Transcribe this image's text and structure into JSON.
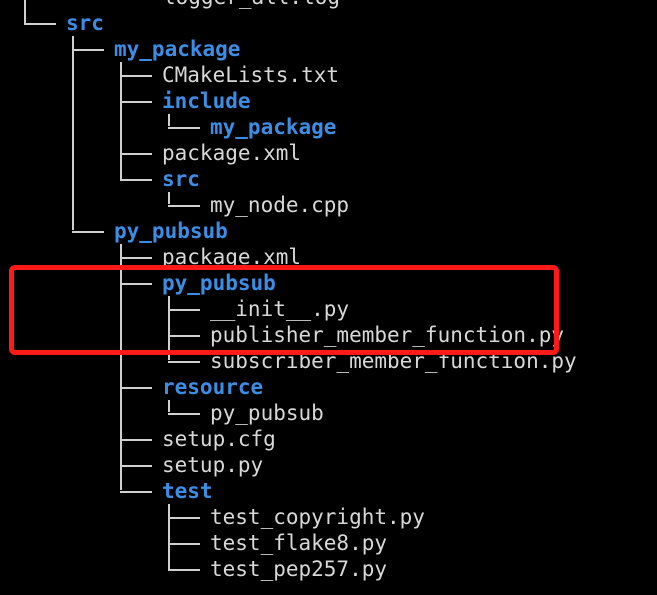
{
  "tree": {
    "entries": [
      {
        "name": "logger_all.log",
        "kind": "file"
      },
      {
        "name": "src",
        "kind": "dir"
      },
      {
        "name": "my_package",
        "kind": "dir"
      },
      {
        "name": "CMakeLists.txt",
        "kind": "file"
      },
      {
        "name": "include",
        "kind": "dir"
      },
      {
        "name": "my_package",
        "kind": "dir"
      },
      {
        "name": "package.xml",
        "kind": "file"
      },
      {
        "name": "src",
        "kind": "dir"
      },
      {
        "name": "my_node.cpp",
        "kind": "file"
      },
      {
        "name": "py_pubsub",
        "kind": "dir"
      },
      {
        "name": "package.xml",
        "kind": "file"
      },
      {
        "name": "py_pubsub",
        "kind": "dir"
      },
      {
        "name": "__init__.py",
        "kind": "file"
      },
      {
        "name": "publisher_member_function.py",
        "kind": "file"
      },
      {
        "name": "subscriber_member_function.py",
        "kind": "file"
      },
      {
        "name": "resource",
        "kind": "dir"
      },
      {
        "name": "py_pubsub",
        "kind": "file"
      },
      {
        "name": "setup.cfg",
        "kind": "file"
      },
      {
        "name": "setup.py",
        "kind": "file"
      },
      {
        "name": "test",
        "kind": "dir"
      },
      {
        "name": "test_copyright.py",
        "kind": "file"
      },
      {
        "name": "test_flake8.py",
        "kind": "file"
      },
      {
        "name": "test_pep257.py",
        "kind": "file"
      }
    ]
  },
  "colors": {
    "background": "#000000",
    "directory": "#3b8ee5",
    "file": "#d8d8d8",
    "highlight": "#ff1a1a"
  }
}
